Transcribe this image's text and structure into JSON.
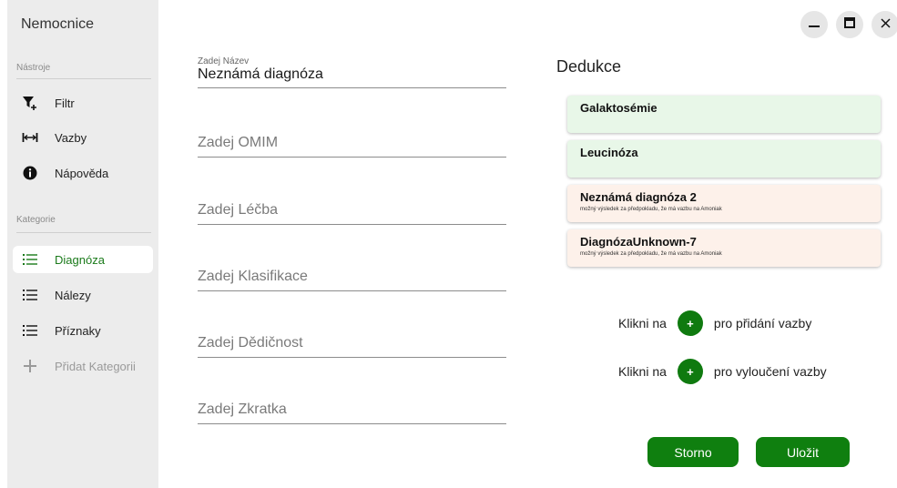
{
  "app": {
    "title": "Nemocnice"
  },
  "sidebar": {
    "tools_label": "Nástroje",
    "tools": [
      {
        "label": "Filtr",
        "icon": "filter-add-icon"
      },
      {
        "label": "Vazby",
        "icon": "link-arrows-icon"
      },
      {
        "label": "Nápověda",
        "icon": "info-icon"
      }
    ],
    "categories_label": "Kategorie",
    "categories": [
      {
        "label": "Diagnóza",
        "icon": "list-icon",
        "active": true
      },
      {
        "label": "Nálezy",
        "icon": "list-icon"
      },
      {
        "label": "Příznaky",
        "icon": "list-icon"
      },
      {
        "label": "Přidat Kategorii",
        "icon": "plus-icon",
        "disabled": true
      }
    ]
  },
  "window": {
    "minimize": "minimize-icon",
    "maximize": "maximize-icon",
    "close": "close-icon"
  },
  "form": {
    "name_label": "Zadej Název",
    "name_value": "Neznámá diagnóza",
    "omim_placeholder": "Zadej OMIM",
    "lecba_placeholder": "Zadej Léčba",
    "klasifikace_placeholder": "Zadej Klasifikace",
    "dedicnost_placeholder": "Zadej Dědičnost",
    "zkratka_placeholder": "Zadej Zkratka"
  },
  "deduction": {
    "title": "Dedukce",
    "items": [
      {
        "name": "Galaktosémie",
        "note": ""
      },
      {
        "name": "Leucinóza",
        "note": ""
      },
      {
        "name": "Neznámá diagnóza 2",
        "note": "možný výsledek za předpokladu, že má vazbu na Amoniak"
      },
      {
        "name": "DiagnózaUnknown-7",
        "note": "možný výsledek za předpokladu, že má vazbu na Amoniak"
      }
    ],
    "hint_prefix": "Klikni na",
    "plus_symbol": "+",
    "add_text": "pro přidání vazby",
    "exclude_text": "pro vyloučení vazby"
  },
  "actions": {
    "cancel": "Storno",
    "save": "Uložit"
  },
  "colors": {
    "accent": "#0f7f0f",
    "card_green": "#e8f7e8",
    "card_peach": "#fdf1ea",
    "sidebar": "#ececec"
  }
}
